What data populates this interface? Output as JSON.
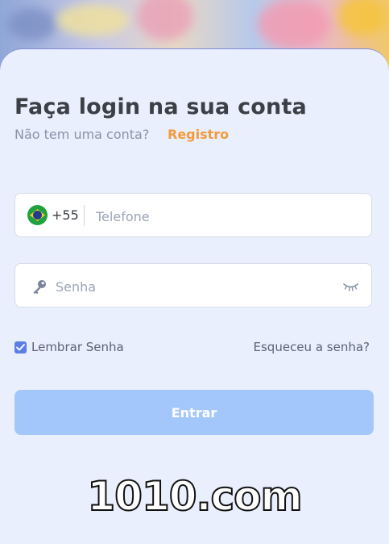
{
  "login": {
    "title": "Faça login na sua conta",
    "no_account_text": "Não tem uma conta?",
    "register_link": "Registro"
  },
  "phone_field": {
    "country_flag": "brazil-flag",
    "country_code": "+55",
    "placeholder": "Telefone",
    "value": ""
  },
  "password_field": {
    "placeholder": "Senha",
    "value": "",
    "leading_icon": "key-icon",
    "toggle_icon": "eye-closed-icon"
  },
  "options": {
    "remember_label": "Lembrar Senha",
    "remember_checked": true,
    "forgot_link": "Esqueceu a senha?"
  },
  "submit_label": "Entrar",
  "watermark": "1010.com",
  "colors": {
    "accent": "#f59a3c",
    "button": "#a4c7fb",
    "checkbox": "#5b7ee5",
    "sheet_background": "#e9effc"
  }
}
